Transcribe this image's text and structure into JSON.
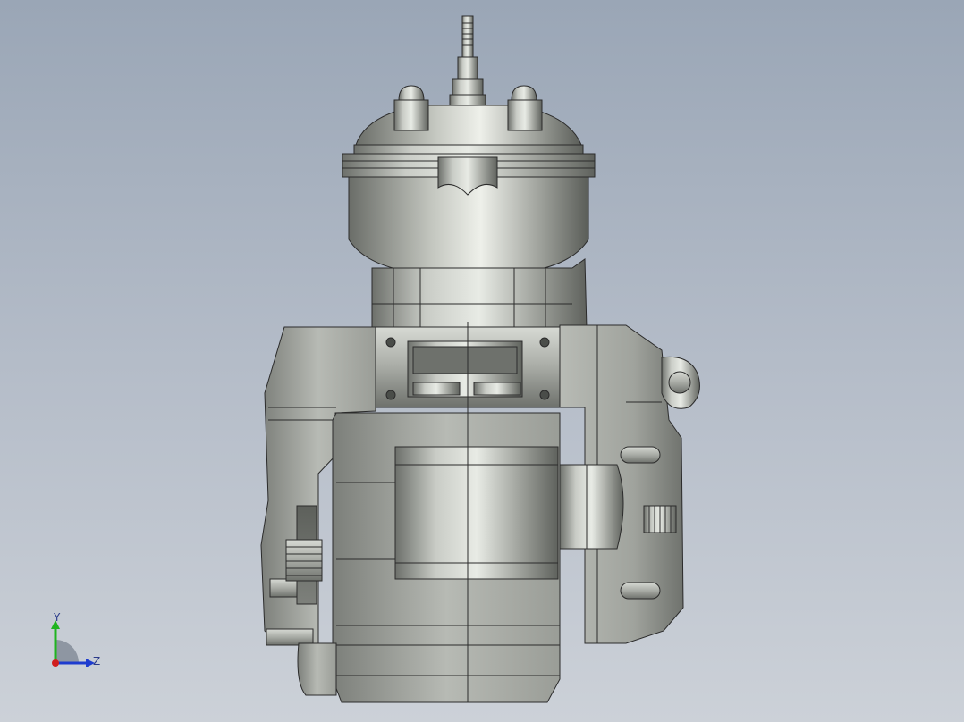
{
  "viewport": {
    "background_top": "#9aa6b6",
    "background_bottom": "#ccd1d8",
    "model_name": "",
    "model_color": "#b9bcb6"
  },
  "triad": {
    "y_label": "Y",
    "z_label": "Z",
    "x_color": "#d01e1e",
    "y_color": "#1fb41f",
    "z_color": "#1e3ccf"
  }
}
